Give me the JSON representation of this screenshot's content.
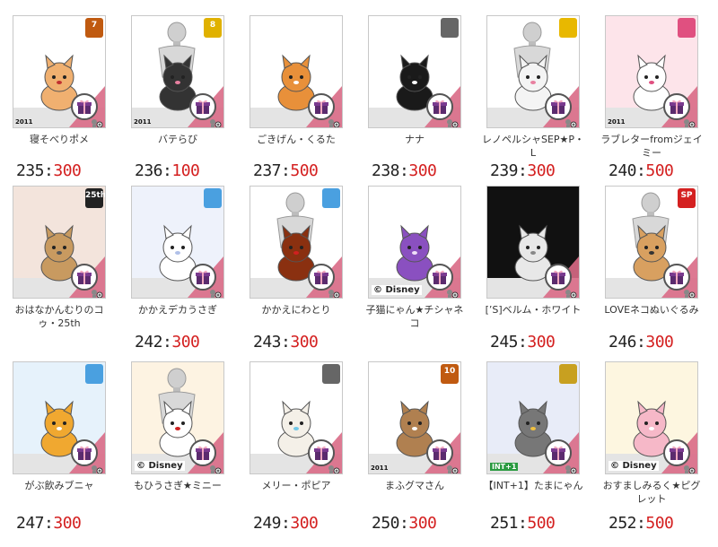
{
  "items": [
    {
      "name": "寝そべりポメ",
      "num": "235",
      "sep": ":",
      "val": "300",
      "badge": "7",
      "badge_color": "#c05a10",
      "bg": "#ffffff",
      "pet": "pom-lying",
      "year": "2011",
      "mannequin": false
    },
    {
      "name": "バテらび",
      "num": "236",
      "sep": ":",
      "val": "100",
      "badge": "8",
      "badge_color": "#e0b100",
      "bg": "#ffffff",
      "pet": "bunny-black",
      "year": "2011",
      "mannequin": true
    },
    {
      "name": "ごきげん・くるた",
      "num": "237",
      "sep": ":",
      "val": "500",
      "badge": "",
      "badge_color": "",
      "bg": "#ffffff",
      "pet": "shiba",
      "year": "",
      "mannequin": false
    },
    {
      "name": "ナナ",
      "num": "238",
      "sep": ":",
      "val": "300",
      "badge": "",
      "badge_color": "#666666",
      "bg": "#ffffff",
      "pet": "dog-black",
      "year": "",
      "mannequin": false
    },
    {
      "name": "レノペルシャSEP★P・L",
      "num": "239",
      "sep": ":",
      "val": "300",
      "badge": "",
      "badge_color": "#e8b800",
      "bg": "#ffffff",
      "pet": "cat-white",
      "year": "",
      "mannequin": true
    },
    {
      "name": "ラブレターfromジェイミー",
      "num": "240",
      "sep": ":",
      "val": "500",
      "badge": "",
      "badge_color": "#e05080",
      "bg": "#fde4ea",
      "pet": "bunny-white",
      "year": "2011",
      "mannequin": false
    },
    {
      "name": "おはなかんむりのコゥ・25th",
      "num": "",
      "sep": "",
      "val": "",
      "badge": "25th",
      "badge_color": "#222222",
      "bg": "#f3e4dc",
      "pet": "cat-tabby",
      "year": "",
      "mannequin": false
    },
    {
      "name": "かかえデカうさぎ",
      "num": "242",
      "sep": ":",
      "val": "300",
      "badge": "",
      "badge_color": "#4aa0e0",
      "bg": "#eef2fb",
      "pet": "bunny-big",
      "year": "",
      "mannequin": false
    },
    {
      "name": "かかえにわとり",
      "num": "243",
      "sep": ":",
      "val": "300",
      "badge": "",
      "badge_color": "#4aa0e0",
      "bg": "#ffffff",
      "pet": "rooster",
      "year": "",
      "mannequin": true
    },
    {
      "name": "子猫にゃん★チシャネコ",
      "num": "",
      "sep": "",
      "val": "",
      "badge": "",
      "badge_color": "",
      "bg": "#ffffff",
      "pet": "cat-purple",
      "year": "",
      "mannequin": false,
      "copy": "© Disney"
    },
    {
      "name": "[’S]ベルム・ホワイト",
      "num": "245",
      "sep": ":",
      "val": "300",
      "badge": "",
      "badge_color": "",
      "bg": "#111111",
      "pet": "cat-ghost",
      "year": "",
      "mannequin": false
    },
    {
      "name": "LOVEネコぬいぐるみ",
      "num": "246",
      "sep": ":",
      "val": "300",
      "badge": "SP",
      "badge_color": "#d42020",
      "bg": "#ffffff",
      "pet": "cat-plush",
      "year": "",
      "mannequin": true
    },
    {
      "name": "がぶ飲みブニャ",
      "num": "247",
      "sep": ":",
      "val": "300",
      "badge": "",
      "badge_color": "#4aa0e0",
      "bg": "#e6f2fb",
      "pet": "cat-orange",
      "year": "",
      "mannequin": false
    },
    {
      "name": "もひうさぎ★ミニー",
      "num": "",
      "sep": "",
      "val": "",
      "badge": "",
      "badge_color": "",
      "bg": "#fdf3e2",
      "pet": "bunny-minnie",
      "year": "",
      "mannequin": true,
      "copy": "© Disney"
    },
    {
      "name": "メリー・ポピア",
      "num": "249",
      "sep": ":",
      "val": "300",
      "badge": "",
      "badge_color": "#666666",
      "bg": "#ffffff",
      "pet": "sheep",
      "year": "",
      "mannequin": false
    },
    {
      "name": "まふグマさん",
      "num": "250",
      "sep": ":",
      "val": "300",
      "badge": "10",
      "badge_color": "#c05a10",
      "bg": "#ffffff",
      "pet": "bear",
      "year": "2011",
      "mannequin": false
    },
    {
      "name": "【INT+1】たまにゃん",
      "num": "251",
      "sep": ":",
      "val": "500",
      "badge": "",
      "badge_color": "#c8a020",
      "bg": "#e8ecf8",
      "pet": "cat-gray",
      "year": "",
      "mannequin": false,
      "tag": "INT+1"
    },
    {
      "name": "おすましみるく★ピグレット",
      "num": "252",
      "sep": ":",
      "val": "500",
      "badge": "",
      "badge_color": "",
      "bg": "#fdf6e0",
      "pet": "piglet",
      "year": "",
      "mannequin": false,
      "copy": "© Disney"
    }
  ],
  "extra_labels": [
    {
      "key": "241",
      "num": "",
      "sep": "",
      "val": ""
    },
    {
      "key": "244",
      "num": "",
      "sep": "",
      "val": ""
    },
    {
      "key": "248",
      "num": "",
      "sep": "",
      "val": ""
    }
  ],
  "icons": {
    "gift": "gift-icon",
    "zoom": "zoom-plus-icon",
    "mannequin": "mannequin-icon"
  },
  "colors": {
    "score_value": "#d42020",
    "flap": "#d96a86",
    "floor": "#e4e4e4"
  }
}
